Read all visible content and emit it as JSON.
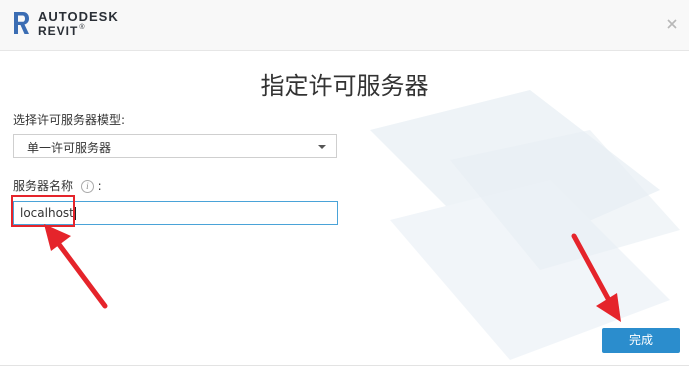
{
  "header": {
    "brand_line1": "AUTODESK",
    "brand_line2": "REVIT",
    "brand_tm": "®",
    "close_icon": "close-icon"
  },
  "dialog": {
    "title": "指定许可服务器",
    "license_type_label": "选择许可服务器模型:",
    "license_type_value": "单一许可服务器",
    "server_name_label": "服务器名称",
    "server_name_suffix": ":",
    "server_name_value": "localhost",
    "info_icon_glyph": "i",
    "finish_label": "完成"
  },
  "colors": {
    "accent": "#2b8dcd",
    "annotation_red": "#e5242b",
    "input_focus": "#4aa3d8"
  }
}
